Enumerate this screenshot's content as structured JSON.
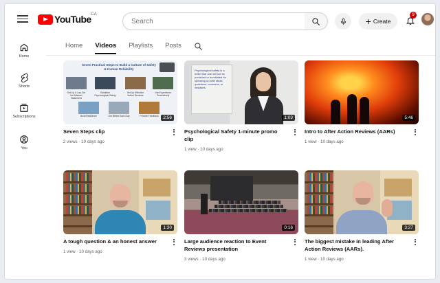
{
  "header": {
    "logo_text": "YouTube",
    "logo_sup": "CA",
    "search_placeholder": "Search",
    "create_label": "Create",
    "notification_count": "9"
  },
  "sidebar": {
    "items": [
      {
        "label": "Home",
        "icon": "home-icon"
      },
      {
        "label": "Shorts",
        "icon": "shorts-icon"
      },
      {
        "label": "Subscriptions",
        "icon": "subscriptions-icon"
      },
      {
        "label": "You",
        "icon": "you-icon"
      }
    ]
  },
  "tabs": [
    {
      "label": "Home"
    },
    {
      "label": "Videos",
      "active": true
    },
    {
      "label": "Playlists"
    },
    {
      "label": "Posts"
    }
  ],
  "videos": [
    {
      "title": "Seven Steps clip",
      "meta": "2 views · 10 days ago",
      "duration": "2:56",
      "thumb_header": "Seven Practical Steps to Build a Culture of Safety & Human Reliability",
      "thumb_captions": [
        "Set Up & Lay Out the Mission Statement",
        "Establish Psychological Safety",
        "Set Up Effective Action Reviews",
        "Use Experience Productively",
        "Build Resilience",
        "Get Better Each Day",
        "Provide Feedback"
      ]
    },
    {
      "title": "Psychological Safety 1-minute promo clip",
      "meta": "1 view · 10 days ago",
      "duration": "1:03",
      "thumb_board_text": "Psychological safety is a belief that one will not be punished or humiliated for speaking up with ideas, questions, concerns, or mistakes."
    },
    {
      "title": "Intro to After Action Reviews (AARs)",
      "meta": "1 view · 10 days ago",
      "duration": "5:46"
    },
    {
      "title": "A tough question & an honest answer",
      "meta": "1 view · 10 days ago",
      "duration": "1:30"
    },
    {
      "title": "Large audience reaction to Event Reviews presentation",
      "meta": "3 views · 10 days ago",
      "duration": "0:16"
    },
    {
      "title": "The biggest mistake in leading After Action Reviews (AARs).",
      "meta": "1 view · 10 days ago",
      "duration": "3:27"
    }
  ]
}
